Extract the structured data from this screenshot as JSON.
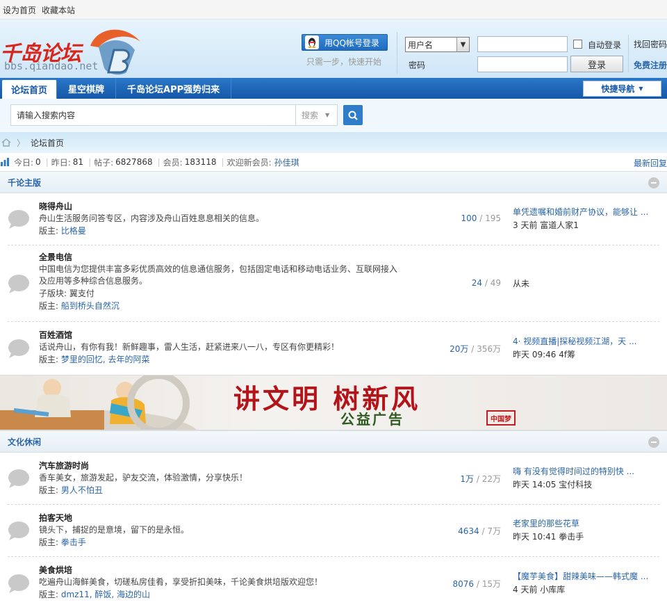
{
  "topbar": {
    "set_home": "设为首页",
    "bookmark": "收藏本站"
  },
  "logo": {
    "cn": "千岛论坛",
    "url": "bbs.qiandao.net"
  },
  "login": {
    "qq_button": "用QQ帐号登录",
    "qq_sub": "只需一步，快速开始",
    "user_select": "用户名",
    "password_label": "密码",
    "auto_login": "自动登录",
    "login_button": "登录",
    "find_password": "找回密码",
    "register": "免费注册"
  },
  "nav": {
    "items": [
      "论坛首页",
      "星空棋牌",
      "千岛论坛APP强势归来"
    ],
    "quick_nav": "快捷导航"
  },
  "search": {
    "placeholder": "请输入搜索内容",
    "select": "搜索"
  },
  "breadcrumb": {
    "home": "论坛首页"
  },
  "stats": {
    "today_label": "今日:",
    "today": "0",
    "yesterday_label": "昨日:",
    "yesterday": "81",
    "posts_label": "帖子:",
    "posts": "6827868",
    "members_label": "会员:",
    "members": "183118",
    "welcome_label": "欢迎新会员:",
    "new_member": "孙佳琪",
    "latest": "最新回复"
  },
  "categories": [
    {
      "title": "千论主版",
      "forums": [
        {
          "name": "晓得舟山",
          "desc": "舟山生活服务问答专区，内容涉及舟山百姓息息相关的信息。",
          "sub": "",
          "mod_label": "版主:",
          "mods": "比格曼",
          "threads": "100",
          "posts": "195",
          "last_title": "单凭遗嘱和婚前财产协议，能够让 ...",
          "last_meta": "3 天前 富道人家1"
        },
        {
          "name": "全景电信",
          "desc": "中国电信为您提供丰富多彩优质高效的信息通信服务，包括固定电话和移动电话业务、互联网接入及应用等多种综合信息服务。",
          "sub": "子版块: 翼支付",
          "mod_label": "版主:",
          "mods": "船到桥头自然沉",
          "threads": "24",
          "posts": "49",
          "last_title": "",
          "last_meta": "从未"
        },
        {
          "name": "百姓酒馆",
          "desc": "话说舟山，有你有我！新鲜趣事，雷人生活，赶紧进来八一八，专区有你更精彩！",
          "sub": "",
          "mod_label": "版主:",
          "mods": "梦里的回忆, 去年的阿菜",
          "threads": "20万",
          "posts": "356万",
          "last_title": "4· 视频直播|探秘视频江湖，天 ...",
          "last_meta": "昨天 09:46 4f筹"
        }
      ]
    },
    {
      "title": "文化休闲",
      "forums": [
        {
          "name": "汽车旅游时尚",
          "desc": "香车美女，旅游发起，驴友交流，体验激情，分享快乐！",
          "sub": "",
          "mod_label": "版主:",
          "mods": "男人不怕丑",
          "threads": "1万",
          "posts": "22万",
          "last_title": "嗨 有没有觉得时间过的特别快 ...",
          "last_meta": "昨天 14:05 宝付科技"
        },
        {
          "name": "拍客天地",
          "desc": "镜头下，捕捉的是意境，留下的是永恒。",
          "sub": "",
          "mod_label": "版主:",
          "mods": "拳击手",
          "threads": "4634",
          "posts": "7万",
          "last_title": "老家里的那些花草",
          "last_meta": "昨天 10:41 拳击手"
        },
        {
          "name": "美食烘培",
          "desc": "吃遍舟山海鲜美食，切磋私房佳肴，享受折扣美味，千论美食烘培版欢迎您！",
          "sub": "",
          "mod_label": "版主:",
          "mods": "dmz11, 醉饭, 海边的山",
          "threads": "8076",
          "posts": "15万",
          "last_title": "【魔芋美食】甜辣美味——韩式魔 ...",
          "last_meta": "4 天前 小库库"
        }
      ]
    }
  ],
  "banner": {
    "slogan": "讲文明 树新风",
    "sub": "公益广告",
    "seal": "中国梦"
  }
}
